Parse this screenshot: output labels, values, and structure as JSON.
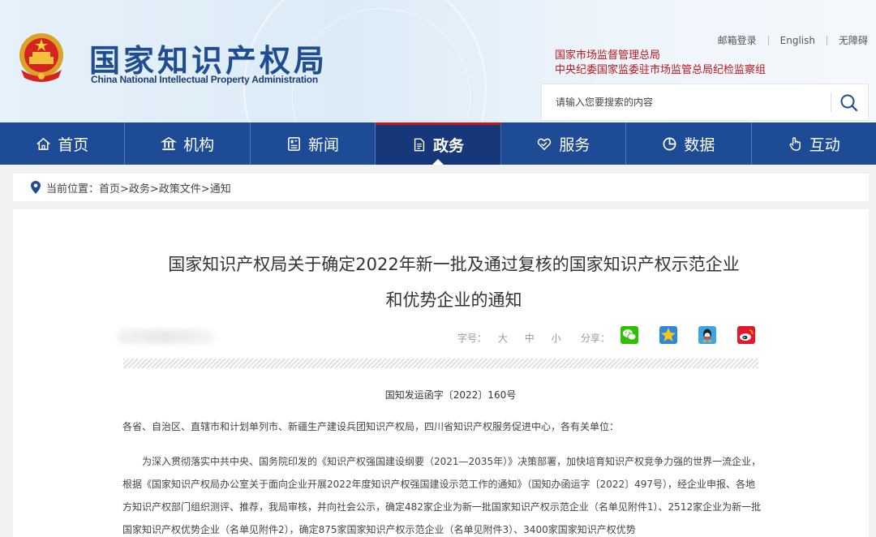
{
  "header": {
    "logo_cn": "国家知识产权局",
    "logo_en": "China National Intellectual Property Administration",
    "links": [
      "邮箱登录",
      "English",
      "无障碍"
    ],
    "orgs": [
      "国家市场监督管理总局",
      "中央纪委国家监委驻市场监管总局纪检监察组"
    ],
    "search": {
      "placeholder": "请输入您要搜索的内容"
    }
  },
  "nav": [
    {
      "label": "首页",
      "icon": "home-icon"
    },
    {
      "label": "机构",
      "icon": "institution-icon"
    },
    {
      "label": "新闻",
      "icon": "news-icon"
    },
    {
      "label": "政务",
      "icon": "document-icon",
      "active": true
    },
    {
      "label": "服务",
      "icon": "service-icon"
    },
    {
      "label": "数据",
      "icon": "data-icon"
    },
    {
      "label": "互动",
      "icon": "interaction-icon"
    }
  ],
  "breadcrumb": {
    "prefix": "当前位置：",
    "path": "首页>政务>政策文件>通知"
  },
  "article": {
    "title_line1": "国家知识产权局关于确定2022年新一批及通过复核的国家知识产权示范企业",
    "title_line2": "和优势企业的通知",
    "font_size_label": "字号：",
    "font_sizes": [
      "大",
      "中",
      "小"
    ],
    "share_label": "分享：",
    "share_icons": [
      "wechat-icon",
      "qzone-icon",
      "qq-icon",
      "weibo-icon"
    ],
    "doc_number": "国知发运函字〔2022〕160号",
    "salutation": "各省、自治区、直辖市和计划单列市、新疆生产建设兵团知识产权局，四川省知识产权服务促进中心，各有关单位：",
    "body": "为深入贯彻落实中共中央、国务院印发的《知识产权强国建设纲要（2021—2035年）》决策部署，加快培育知识产权竞争力强的世界一流企业，根据《国家知识产权局办公室关于面向企业开展2022年度知识产权强国建设示范工作的通知》（国知办函运字〔2022〕497号），经企业申报、各地方知识产权部门组织测评、推荐，我局审核，并向社会公示，确定482家企业为新一批国家知识产权示范企业（名单见附件1）、2512家企业为新一批国家知识产权优势企业（名单见附件2），确定875家国家知识产权示范企业（名单见附件3）、3400家国家知识产权优势"
  },
  "colors": {
    "nav_bg": "#1d4b96",
    "accent_red": "#c8161d",
    "logo_blue": "#1e4d92"
  }
}
